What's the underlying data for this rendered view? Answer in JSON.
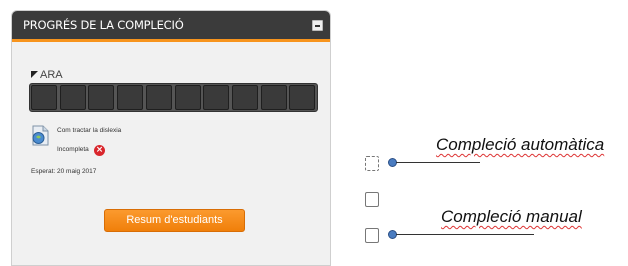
{
  "block": {
    "title": "PROGRÉS DE LA COMPLECIÓ",
    "now_label": "ARA",
    "progress": {
      "cells": 10,
      "completed": 0
    },
    "activity": {
      "name": "Com tractar la dislexia",
      "status": "Incompleta",
      "expected": "Esperat: 20 maig 2017"
    },
    "summary_button": "Resum d'estudiants"
  },
  "legend": {
    "automatic_label": "Compleció automàtica",
    "manual_label": "Compleció manual"
  },
  "colors": {
    "header_bg": "#3b3b3b",
    "accent_orange": "#f7941d",
    "incomplete_red": "#d9262c",
    "legend_dot": "#4a7cc0"
  }
}
